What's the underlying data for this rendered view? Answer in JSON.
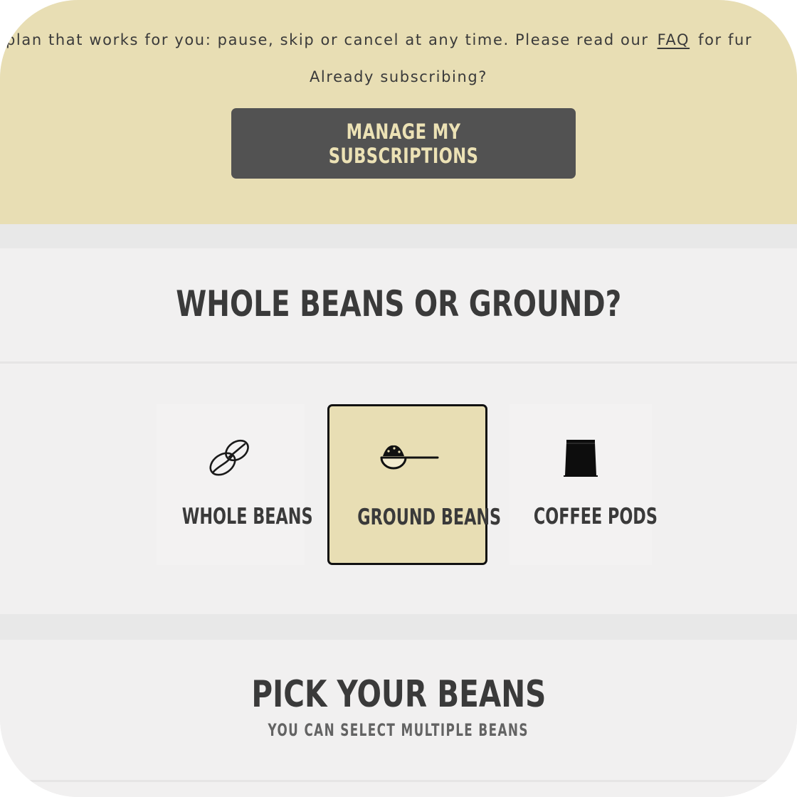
{
  "subscription_banner": {
    "intro_before_link": "plan that works for you: pause, skip or cancel at any time. Please read our",
    "faq_link": "FAQ",
    "intro_after_link": "for fur",
    "already_subscribing": "Already subscribing?",
    "manage_button_label": "MANAGE MY SUBSCRIPTIONS"
  },
  "grind_section": {
    "heading": "WHOLE BEANS OR GROUND?",
    "options": [
      {
        "label": "WHOLE BEANS",
        "icon": "coffee-beans-icon",
        "selected": false
      },
      {
        "label": "GROUND BEANS",
        "icon": "coffee-scoop-icon",
        "selected": true
      },
      {
        "label": "COFFEE PODS",
        "icon": "coffee-pod-icon",
        "selected": false
      }
    ]
  },
  "beans_section": {
    "heading": "PICK YOUR BEANS",
    "subheading": "YOU CAN SELECT MULTIPLE BEANS"
  },
  "colors": {
    "banner_background": "#e8deb4",
    "button_background": "#525252",
    "button_text": "#ece2b5",
    "heading_text": "#3a3a3a",
    "page_background": "#f1f0f0",
    "selected_border": "#111111"
  }
}
